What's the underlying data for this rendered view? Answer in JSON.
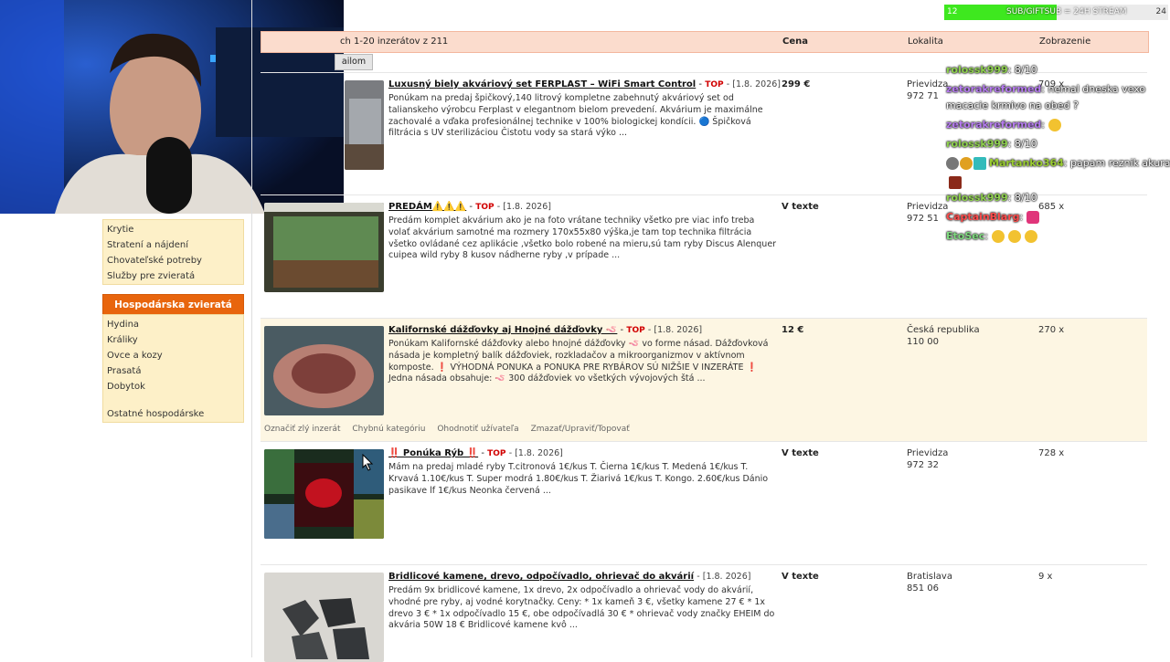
{
  "header": {
    "results": "ch 1-20 inzerátov z 211",
    "col_price": "Cena",
    "col_location": "Lokalita",
    "col_views": "Zobrazenie",
    "button_label": "ailom"
  },
  "sidebar": {
    "items_top": [
      "Krytie",
      "Stratení a nájdení",
      "Chovateľské potreby",
      "Služby pre zvieratá"
    ],
    "section_title": "Hospodárska zvieratá",
    "items_bottom": [
      "Hydina",
      "Králiky",
      "Ovce a kozy",
      "Prasatá",
      "Dobytok"
    ],
    "items_last": "Ostatné hospodárske"
  },
  "listings": [
    {
      "title": "Luxusný biely akváriový set FERPLAST – WiFi Smart Control",
      "top": "TOP",
      "date": "[1.8. 2026]",
      "desc": "Ponúkam na predaj špičkový,140 litrový kompletne zabehnutý akváriový set od talianskeho výrobcu Ferplast v elegantnom bielom prevedení. Akvárium je maximálne zachovalé a vďaka profesionálnej technike v 100% biologickej kondícii. 🔵 Špičková filtrácia s UV sterilizáciou Čistotu vody sa stará výko ...",
      "price": "299 €",
      "location": "Prievidza",
      "zip": "972 71",
      "views": "709 x"
    },
    {
      "title": "PREDÁM⚠️⚠️⚠️",
      "top": "TOP",
      "date": "[1.8. 2026]",
      "desc": "Predám komplet akvárium ako je na foto vrátane techniky všetko pre viac info treba volať akvárium samotné ma rozmery 170x55x80 výška,je tam top technika filtrácia všetko ovládané cez aplikácie ,všetko bolo robené na mieru,sú tam ryby Discus Alenquer cuipea wild ryby 8 kusov nádherne ryby ,v prípade ...",
      "price": "V texte",
      "location": "Prievidza",
      "zip": "972 51",
      "views": "685 x"
    },
    {
      "title": "Kalifornské dážďovky aj Hnojné dážďovky 🪱",
      "top": "TOP",
      "date": "[1.8. 2026]",
      "desc": "Ponúkam Kalifornské dážďovky alebo hnojné dážďovky 🪱 vo forme násad. Dážďovková násada je kompletný balík dážďoviek, rozkladačov a mikroorganizmov v aktívnom komposte. ❗ VÝHODNÁ PONUKA a PONUKA PRE RYBÁROV SÚ NIŽŠIE V INZERÁTE ❗ Jedna násada obsahuje: 🪱 300 dážďoviek vo všetkých vývojových štá ...",
      "price": "12 €",
      "location": "Česká republika",
      "zip": "110 00",
      "views": "270 x",
      "actions": [
        "Označiť zlý inzerát",
        "Chybnú kategóriu",
        "Ohodnotiť užívateľa",
        "Zmazať/Upraviť/Topovať"
      ]
    },
    {
      "title": "‼️ Ponúka Rýb ‼️",
      "top": "TOP",
      "date": "[1.8. 2026]",
      "desc": "Mám na predaj mladé ryby T.citronová 1€/kus T. Čierna 1€/kus T. Medená 1€/kus T. Krvavá 1.10€/kus T. Super modrá 1.80€/kus T. Žiarivá 1€/kus T. Kongo. 2.60€/kus Dánio pasikave lf 1€/kus Neonka červená ...",
      "price": "V texte",
      "location": "Prievidza",
      "zip": "972 32",
      "views": "728 x"
    },
    {
      "title": "Bridlicové kamene, drevo, odpočívadlo, ohrievač do akvárií",
      "top": "",
      "date": "[1.8. 2026]",
      "desc": "Predám 9x bridlicové kamene, 1x drevo, 2x odpočívadlo a ohrievač vody do akvárií, vhodné pre ryby, aj vodné korytnačky. Ceny: * 1x kameň 3 €, všetky kamene 27 € * 1x drevo 3 € * 1x odpočívadlo 15 €, obe odpočívadlá 30 € * ohrievač vody značky EHEIM do akvária 50W 18 € Bridlicové kamene kvô ...",
      "price": "V texte",
      "location": "Bratislava",
      "zip": "851 06",
      "views": "9 x"
    }
  ],
  "overlay": {
    "sub_left": "12",
    "sub_label": "SUB/GIFTSUB = 24H STREAM",
    "sub_right": "24",
    "sub_progress": 0.5,
    "chat": [
      {
        "name": "rolossk999",
        "color": "#8fd14f",
        "text": ": 8/10"
      },
      {
        "name": "zetorakreformed",
        "color": "#b57bee",
        "text": ": nemal dneska vexo"
      },
      {
        "name": "",
        "color": "#ffffff",
        "text": "macacie krmivo na obed ?"
      },
      {
        "name": "zetorakreformed",
        "color": "#b57bee",
        "text": ":"
      },
      {
        "name": "rolossk999",
        "color": "#8fd14f",
        "text": ": 8/10"
      },
      {
        "name": "Martanko364",
        "color": "#9acd32",
        "text": ": papam reznik akurat"
      },
      {
        "name": "",
        "color": "#ffffff",
        "text": ""
      },
      {
        "name": "rolossk999",
        "color": "#8fd14f",
        "text": ": 8/10"
      },
      {
        "name": "CaptainBlarg",
        "color": "#ff4d4d",
        "text": ":"
      },
      {
        "name": "EtoSec",
        "color": "#7fd97f",
        "text": ":"
      }
    ]
  }
}
